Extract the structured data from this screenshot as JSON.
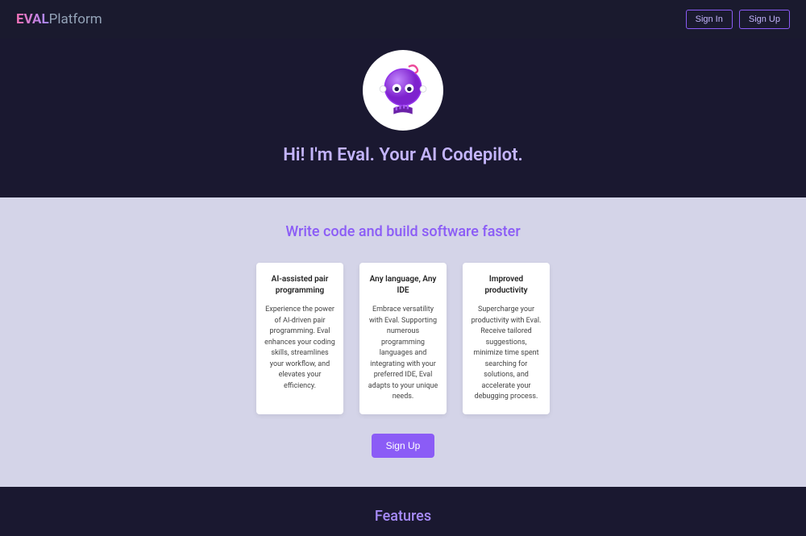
{
  "header": {
    "logo_part1": "EVAL",
    "logo_part2": "Platform",
    "signin": "Sign In",
    "signup": "Sign Up"
  },
  "hero": {
    "heading": "Hi! I'm Eval. Your AI Codepilot."
  },
  "intro": {
    "heading": "Write code and build software faster",
    "cards": [
      {
        "title": "AI-assisted pair programming",
        "body": "Experience the power of AI-driven pair programming. Eval enhances your coding skills, streamlines your workflow, and elevates your efficiency."
      },
      {
        "title": "Any language, Any IDE",
        "body": "Embrace versatility with Eval. Supporting numerous programming languages and integrating with your preferred IDE, Eval adapts to your unique needs."
      },
      {
        "title": "Improved productivity",
        "body": "Supercharge your productivity with Eval. Receive tailored suggestions, minimize time spent searching for solutions, and accelerate your debugging process."
      }
    ],
    "cta": "Sign Up"
  },
  "features": {
    "heading": "Features"
  }
}
